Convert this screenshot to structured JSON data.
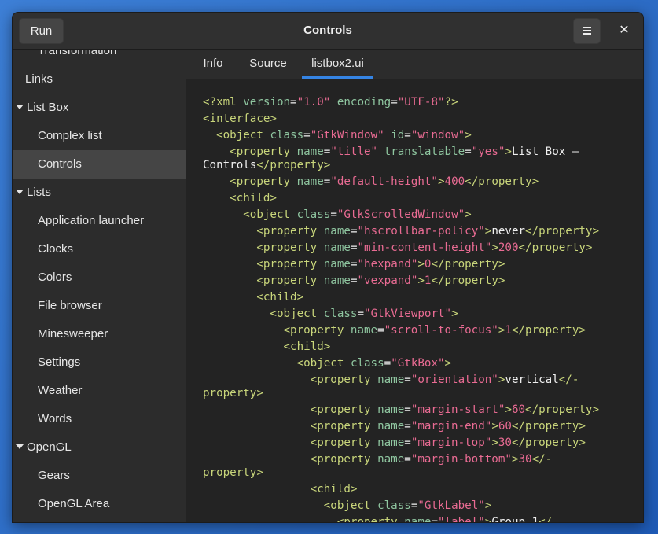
{
  "window": {
    "title": "Controls",
    "run_label": "Run",
    "menu_icon": "hamburger-menu-icon",
    "close_glyph": "✕"
  },
  "sidebar": {
    "items": [
      {
        "label": "Transformation",
        "level": "child"
      },
      {
        "label": "Links",
        "level": "top"
      },
      {
        "label": "List Box",
        "level": "section"
      },
      {
        "label": "Complex list",
        "level": "child"
      },
      {
        "label": "Controls",
        "level": "child",
        "selected": true
      },
      {
        "label": "Lists",
        "level": "section"
      },
      {
        "label": "Application launcher",
        "level": "child"
      },
      {
        "label": "Clocks",
        "level": "child"
      },
      {
        "label": "Colors",
        "level": "child"
      },
      {
        "label": "File browser",
        "level": "child"
      },
      {
        "label": "Minesweeper",
        "level": "child"
      },
      {
        "label": "Settings",
        "level": "child"
      },
      {
        "label": "Weather",
        "level": "child"
      },
      {
        "label": "Words",
        "level": "child"
      },
      {
        "label": "OpenGL",
        "level": "section"
      },
      {
        "label": "Gears",
        "level": "child"
      },
      {
        "label": "OpenGL Area",
        "level": "child"
      }
    ]
  },
  "tabs": [
    {
      "label": "Info"
    },
    {
      "label": "Source"
    },
    {
      "label": "listbox2.ui",
      "active": true
    }
  ],
  "colors": {
    "accent": "#3584e4",
    "tag": "#c9d67b",
    "attribute": "#8fc6a0",
    "string": "#e96b93"
  },
  "code_lines": [
    [
      [
        "t",
        "<?xml "
      ],
      [
        "a",
        "version"
      ],
      [
        "p",
        "="
      ],
      [
        "s",
        "\"1.0\""
      ],
      [
        "a",
        " encoding"
      ],
      [
        "p",
        "="
      ],
      [
        "s",
        "\"UTF-8\""
      ],
      [
        "t",
        "?>"
      ]
    ],
    [
      [
        "t",
        "<interface>"
      ]
    ],
    [
      [
        "p",
        "  "
      ],
      [
        "t",
        "<object "
      ],
      [
        "a",
        "class"
      ],
      [
        "p",
        "="
      ],
      [
        "s",
        "\"GtkWindow\""
      ],
      [
        "a",
        " id"
      ],
      [
        "p",
        "="
      ],
      [
        "s",
        "\"window\""
      ],
      [
        "t",
        ">"
      ]
    ],
    [
      [
        "p",
        "    "
      ],
      [
        "t",
        "<property "
      ],
      [
        "a",
        "name"
      ],
      [
        "p",
        "="
      ],
      [
        "s",
        "\"title\""
      ],
      [
        "a",
        " translatable"
      ],
      [
        "p",
        "="
      ],
      [
        "s",
        "\"yes\""
      ],
      [
        "t",
        ">"
      ],
      [
        "p",
        "List Box –"
      ]
    ],
    [
      [
        "p",
        "Controls"
      ],
      [
        "t",
        "</property>"
      ]
    ],
    [
      [
        "p",
        "    "
      ],
      [
        "t",
        "<property "
      ],
      [
        "a",
        "name"
      ],
      [
        "p",
        "="
      ],
      [
        "s",
        "\"default-height\""
      ],
      [
        "t",
        ">"
      ],
      [
        "s",
        "400"
      ],
      [
        "t",
        "</property>"
      ]
    ],
    [
      [
        "p",
        "    "
      ],
      [
        "t",
        "<child>"
      ]
    ],
    [
      [
        "p",
        "      "
      ],
      [
        "t",
        "<object "
      ],
      [
        "a",
        "class"
      ],
      [
        "p",
        "="
      ],
      [
        "s",
        "\"GtkScrolledWindow\""
      ],
      [
        "t",
        ">"
      ]
    ],
    [
      [
        "p",
        "        "
      ],
      [
        "t",
        "<property "
      ],
      [
        "a",
        "name"
      ],
      [
        "p",
        "="
      ],
      [
        "s",
        "\"hscrollbar-policy\""
      ],
      [
        "t",
        ">"
      ],
      [
        "p",
        "never"
      ],
      [
        "t",
        "</property>"
      ]
    ],
    [
      [
        "p",
        "        "
      ],
      [
        "t",
        "<property "
      ],
      [
        "a",
        "name"
      ],
      [
        "p",
        "="
      ],
      [
        "s",
        "\"min-content-height\""
      ],
      [
        "t",
        ">"
      ],
      [
        "s",
        "200"
      ],
      [
        "t",
        "</property>"
      ]
    ],
    [
      [
        "p",
        "        "
      ],
      [
        "t",
        "<property "
      ],
      [
        "a",
        "name"
      ],
      [
        "p",
        "="
      ],
      [
        "s",
        "\"hexpand\""
      ],
      [
        "t",
        ">"
      ],
      [
        "s",
        "0"
      ],
      [
        "t",
        "</property>"
      ]
    ],
    [
      [
        "p",
        "        "
      ],
      [
        "t",
        "<property "
      ],
      [
        "a",
        "name"
      ],
      [
        "p",
        "="
      ],
      [
        "s",
        "\"vexpand\""
      ],
      [
        "t",
        ">"
      ],
      [
        "s",
        "1"
      ],
      [
        "t",
        "</property>"
      ]
    ],
    [
      [
        "p",
        "        "
      ],
      [
        "t",
        "<child>"
      ]
    ],
    [
      [
        "p",
        "          "
      ],
      [
        "t",
        "<object "
      ],
      [
        "a",
        "class"
      ],
      [
        "p",
        "="
      ],
      [
        "s",
        "\"GtkViewport\""
      ],
      [
        "t",
        ">"
      ]
    ],
    [
      [
        "p",
        "            "
      ],
      [
        "t",
        "<property "
      ],
      [
        "a",
        "name"
      ],
      [
        "p",
        "="
      ],
      [
        "s",
        "\"scroll-to-focus\""
      ],
      [
        "t",
        ">"
      ],
      [
        "s",
        "1"
      ],
      [
        "t",
        "</property>"
      ]
    ],
    [
      [
        "p",
        "            "
      ],
      [
        "t",
        "<child>"
      ]
    ],
    [
      [
        "p",
        "              "
      ],
      [
        "t",
        "<object "
      ],
      [
        "a",
        "class"
      ],
      [
        "p",
        "="
      ],
      [
        "s",
        "\"GtkBox\""
      ],
      [
        "t",
        ">"
      ]
    ],
    [
      [
        "p",
        "                "
      ],
      [
        "t",
        "<property "
      ],
      [
        "a",
        "name"
      ],
      [
        "p",
        "="
      ],
      [
        "s",
        "\"orientation\""
      ],
      [
        "t",
        ">"
      ],
      [
        "p",
        "vertical"
      ],
      [
        "t",
        "</-"
      ]
    ],
    [
      [
        "t",
        "property>"
      ]
    ],
    [
      [
        "p",
        "                "
      ],
      [
        "t",
        "<property "
      ],
      [
        "a",
        "name"
      ],
      [
        "p",
        "="
      ],
      [
        "s",
        "\"margin-start\""
      ],
      [
        "t",
        ">"
      ],
      [
        "s",
        "60"
      ],
      [
        "t",
        "</property>"
      ]
    ],
    [
      [
        "p",
        "                "
      ],
      [
        "t",
        "<property "
      ],
      [
        "a",
        "name"
      ],
      [
        "p",
        "="
      ],
      [
        "s",
        "\"margin-end\""
      ],
      [
        "t",
        ">"
      ],
      [
        "s",
        "60"
      ],
      [
        "t",
        "</property>"
      ]
    ],
    [
      [
        "p",
        "                "
      ],
      [
        "t",
        "<property "
      ],
      [
        "a",
        "name"
      ],
      [
        "p",
        "="
      ],
      [
        "s",
        "\"margin-top\""
      ],
      [
        "t",
        ">"
      ],
      [
        "s",
        "30"
      ],
      [
        "t",
        "</property>"
      ]
    ],
    [
      [
        "p",
        "                "
      ],
      [
        "t",
        "<property "
      ],
      [
        "a",
        "name"
      ],
      [
        "p",
        "="
      ],
      [
        "s",
        "\"margin-bottom\""
      ],
      [
        "t",
        ">"
      ],
      [
        "s",
        "30"
      ],
      [
        "t",
        "</-"
      ]
    ],
    [
      [
        "t",
        "property>"
      ]
    ],
    [
      [
        "p",
        "                "
      ],
      [
        "t",
        "<child>"
      ]
    ],
    [
      [
        "p",
        "                  "
      ],
      [
        "t",
        "<object "
      ],
      [
        "a",
        "class"
      ],
      [
        "p",
        "="
      ],
      [
        "s",
        "\"GtkLabel\""
      ],
      [
        "t",
        ">"
      ]
    ],
    [
      [
        "p",
        "                    "
      ],
      [
        "t",
        "<property "
      ],
      [
        "a",
        "name"
      ],
      [
        "p",
        "="
      ],
      [
        "s",
        "\"label\""
      ],
      [
        "t",
        ">"
      ],
      [
        "p",
        "Group 1"
      ],
      [
        "t",
        "</"
      ]
    ]
  ]
}
